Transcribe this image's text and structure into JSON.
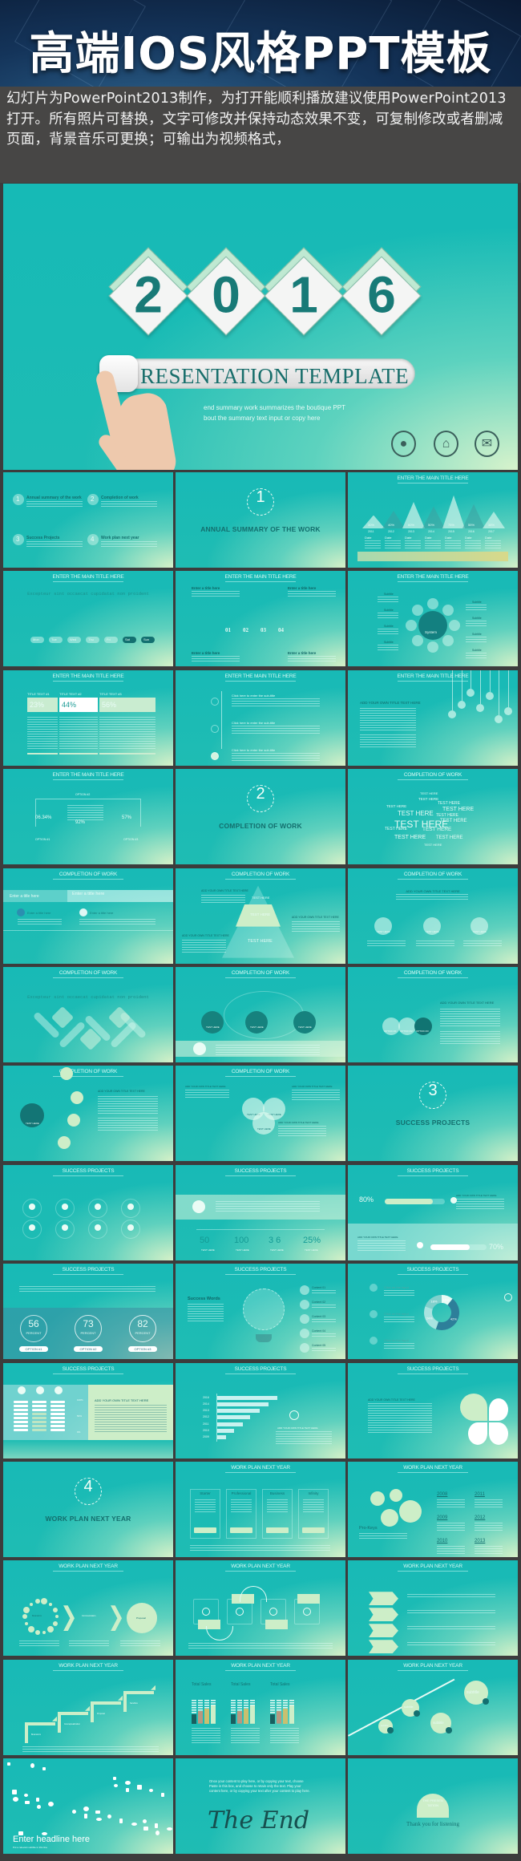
{
  "header": {
    "title": "高端IOS风格PPT模板",
    "description": "幻灯片为PowerPoint2013制作，为打开能顺利播放建议使用PowerPoint2013打开。所有照片可替换，文字可修改并保持动态效果不变，可复制修改或者删减页面，背景音乐可更换；可输出为视频格式，"
  },
  "hero": {
    "digits": [
      "2",
      "0",
      "1",
      "6"
    ],
    "banner": "RESENTATION TEMPLATE",
    "subtitle_lines": [
      "end summary work summarizes the boutique PPT",
      "bout the summary text input or copy here"
    ],
    "icons": [
      "location-pin-icon",
      "home-icon",
      "mail-icon"
    ]
  },
  "colors": {
    "teal": "#1bbbb5",
    "light": "#d6f1c8",
    "dark_teal": "#136e6d",
    "page_bg": "#3c3c3c"
  },
  "slides": [
    {
      "type": "agenda",
      "items": [
        {
          "num": "1",
          "label": "Annual summary of the work"
        },
        {
          "num": "2",
          "label": "Completion of work"
        },
        {
          "num": "3",
          "label": "Success Projects"
        },
        {
          "num": "4",
          "label": "Work plan next year"
        }
      ]
    },
    {
      "type": "section",
      "num": "1",
      "heading": "ANNUAL SUMMARY OF THE WORK"
    },
    {
      "type": "peaks",
      "title": "ENTER THE MAIN TITLE HERE",
      "values": [
        "30%",
        "40%",
        "60%",
        "50%",
        "75%",
        "55%",
        "38%"
      ],
      "years": [
        "2011",
        "2012",
        "2013",
        "2014",
        "2015",
        "2016",
        "2017"
      ],
      "label": "Date"
    },
    {
      "type": "timeline",
      "title": "ENTER THE MAIN TITLE HERE",
      "subtitle": "Excepteur sint occaecat cupidatat non proident",
      "days": [
        "Mon",
        "Tue",
        "Wed",
        "Thu",
        "Fri",
        "Sat",
        "Sun"
      ]
    },
    {
      "type": "numbers",
      "title": "ENTER THE MAIN TITLE HERE",
      "numbers": [
        "01",
        "02",
        "03",
        "04"
      ],
      "label": "Enter a title here"
    },
    {
      "type": "system",
      "title": "ENTER THE MAIN TITLE HERE",
      "center": "System",
      "label": "Subtitle"
    },
    {
      "type": "columns3",
      "title": "ENTER THE MAIN TITLE HERE",
      "cols": [
        {
          "head": "TITLE TEXT #1",
          "value": "23%"
        },
        {
          "head": "TITLE TEXT #2",
          "value": "44%"
        },
        {
          "head": "TITLE TEXT #3",
          "value": "56%"
        }
      ]
    },
    {
      "type": "subs",
      "title": "ENTER THE MAIN TITLE HERE",
      "label": "Click here to enter the sub-title"
    },
    {
      "type": "hanging",
      "title": "ENTER THE MAIN TITLE HERE",
      "heading": "ADD YOUR OWN TITLE TEXT HERE"
    },
    {
      "type": "options",
      "title": "ENTER THE MAIN TITLE HERE",
      "values": [
        "06.34%",
        "92%",
        "57%"
      ],
      "options": [
        "OPTION #1",
        "OPTION #2",
        "OPTION #3"
      ]
    },
    {
      "type": "section",
      "num": "2",
      "heading": "COMPLETION OF WORK"
    },
    {
      "type": "cloud",
      "title": "COMPLETION OF WORK",
      "word": "TEST HERE"
    },
    {
      "type": "tabs",
      "title": "COMPLETION OF WORK",
      "tabs": [
        "Enter a title here",
        "Enter a title here"
      ],
      "items": [
        "Enter a title here",
        "Enter a title here"
      ]
    },
    {
      "type": "pyramid",
      "title": "COMPLETION OF WORK",
      "levels": [
        "TEST HERE",
        "TEST HERE",
        "TEST HERE"
      ],
      "heading": "ADD YOUR OWN TITLE TEXT HERE"
    },
    {
      "type": "circles3",
      "title": "COMPLETION OF WORK",
      "heading": "ADD YOUR OWN TITLE TEXT HERE",
      "label": "TEST HERE"
    },
    {
      "type": "diamonds",
      "title": "COMPLETION OF WORK",
      "subtitle": "Excepteur sint occaecat cupidatat non proident"
    },
    {
      "type": "darkcircles",
      "title": "COMPLETION OF WORK",
      "label": "TEST HERE"
    },
    {
      "type": "optcircles",
      "title": "COMPLETION OF WORK",
      "heading": "ADD YOUR OWN TITLE TEXT HERE",
      "options": [
        "OPTION #1",
        "OPTION #2",
        "OPTION #3"
      ]
    },
    {
      "type": "hub",
      "title": "COMPLETION OF WORK",
      "center": "TEST HERE",
      "heading": "ADD YOUR OWN TITLE TEXT HERE"
    },
    {
      "type": "venn",
      "title": "COMPLETION OF WORK",
      "label": "TEST HERE",
      "heading": "ADD YOUR OWN TITLE TEXT HERE"
    },
    {
      "type": "section",
      "num": "3",
      "heading": "SUCCESS PROJECTS"
    },
    {
      "type": "iconsgrid",
      "title": "SUCCESS PROJECTS"
    },
    {
      "type": "stats",
      "title": "SUCCESS PROJECTS",
      "stats": [
        "50",
        "100",
        "3 6",
        "25%"
      ],
      "label": "TEST HERE"
    },
    {
      "type": "progress",
      "title": "SUCCESS PROJECTS",
      "bars": [
        {
          "value": 80,
          "text": "80%"
        },
        {
          "value": 70,
          "text": "70%"
        }
      ],
      "heading": "ADD YOUR OWN TITLE TEXT HERE"
    },
    {
      "type": "percent",
      "title": "SUCCESS PROJECTS",
      "values": [
        56,
        73,
        82
      ],
      "unit": "PERCENT",
      "options": [
        "OPTION #1",
        "OPTION #2",
        "OPTION #3"
      ]
    },
    {
      "type": "bulb",
      "title": "SUCCESS PROJECTS",
      "heading": "Success Words",
      "contents": [
        "Content 01",
        "Content 02",
        "Content 03",
        "Content 04",
        "Content 05"
      ]
    },
    {
      "type": "donut",
      "title": "SUCCESS PROJECTS",
      "label": "Click on the input",
      "segments": [
        {
          "text": "10%",
          "value": 10
        },
        {
          "text": "42%",
          "value": 42
        },
        {
          "text": "24%",
          "value": 24
        },
        {
          "text": "18%",
          "value": 18
        }
      ]
    },
    {
      "type": "table",
      "title": "SUCCESS PROJECTS",
      "heading": "ADD YOUR OWN TITLE TEXT HERE",
      "scale": [
        "100%",
        "50%",
        "0%"
      ]
    },
    {
      "type": "hbars",
      "title": "SUCCESS PROJECTS",
      "years": [
        "2016",
        "2014",
        "2013",
        "2012",
        "2011",
        "2010",
        "2009"
      ],
      "values": [
        100,
        85,
        71,
        55,
        42,
        28,
        15
      ],
      "heading": "ADD YOUR OWN TITLE TEXT HERE"
    },
    {
      "type": "clover",
      "title": "SUCCESS PROJECTS",
      "heading": "ADD YOUR OWN TITLE TEXT HERE"
    },
    {
      "type": "section",
      "num": "4",
      "heading": "WORK PLAN NEXT YEAR"
    },
    {
      "type": "pricing",
      "title": "WORK PLAN NEXT YEAR",
      "plans": [
        "Starter",
        "Professional",
        "Business",
        "Infinity"
      ]
    },
    {
      "type": "gears",
      "title": "WORK PLAN NEXT YEAR",
      "heading": "Pro-Keys",
      "years": [
        "2008",
        "2011",
        "2009",
        "2012",
        "2010",
        "2013"
      ]
    },
    {
      "type": "process",
      "title": "WORK PLAN NEXT YEAR",
      "steps": [
        "Brainstorm",
        "Communication",
        "Proposal"
      ]
    },
    {
      "type": "cycle",
      "title": "WORK PLAN NEXT YEAR"
    },
    {
      "type": "chevrons",
      "title": "WORK PLAN NEXT YEAR"
    },
    {
      "type": "stairs",
      "title": "WORK PLAN NEXT YEAR",
      "steps": [
        "Brainstorm",
        "Conceptualization",
        "Proposal",
        "Sandbox"
      ]
    },
    {
      "type": "sales",
      "title": "WORK PLAN NEXT YEAR",
      "heading": "Total Sales"
    },
    {
      "type": "bubbles",
      "title": "WORK PLAN NEXT YEAR",
      "label": "subtitle"
    },
    {
      "type": "headline",
      "heading": "Enter headline here",
      "sub": "Put a relevant subtitle in this line"
    },
    {
      "type": "end",
      "text": "Once your content to play here, or by copying your text, choose Paste in this box, and choose to retain only the text. Play your content here, or by copying your text after your content to play here.",
      "heading": "The End"
    },
    {
      "type": "thanks",
      "badge": "THE PRESEN TATION",
      "heading": "Thank you for listening"
    }
  ]
}
